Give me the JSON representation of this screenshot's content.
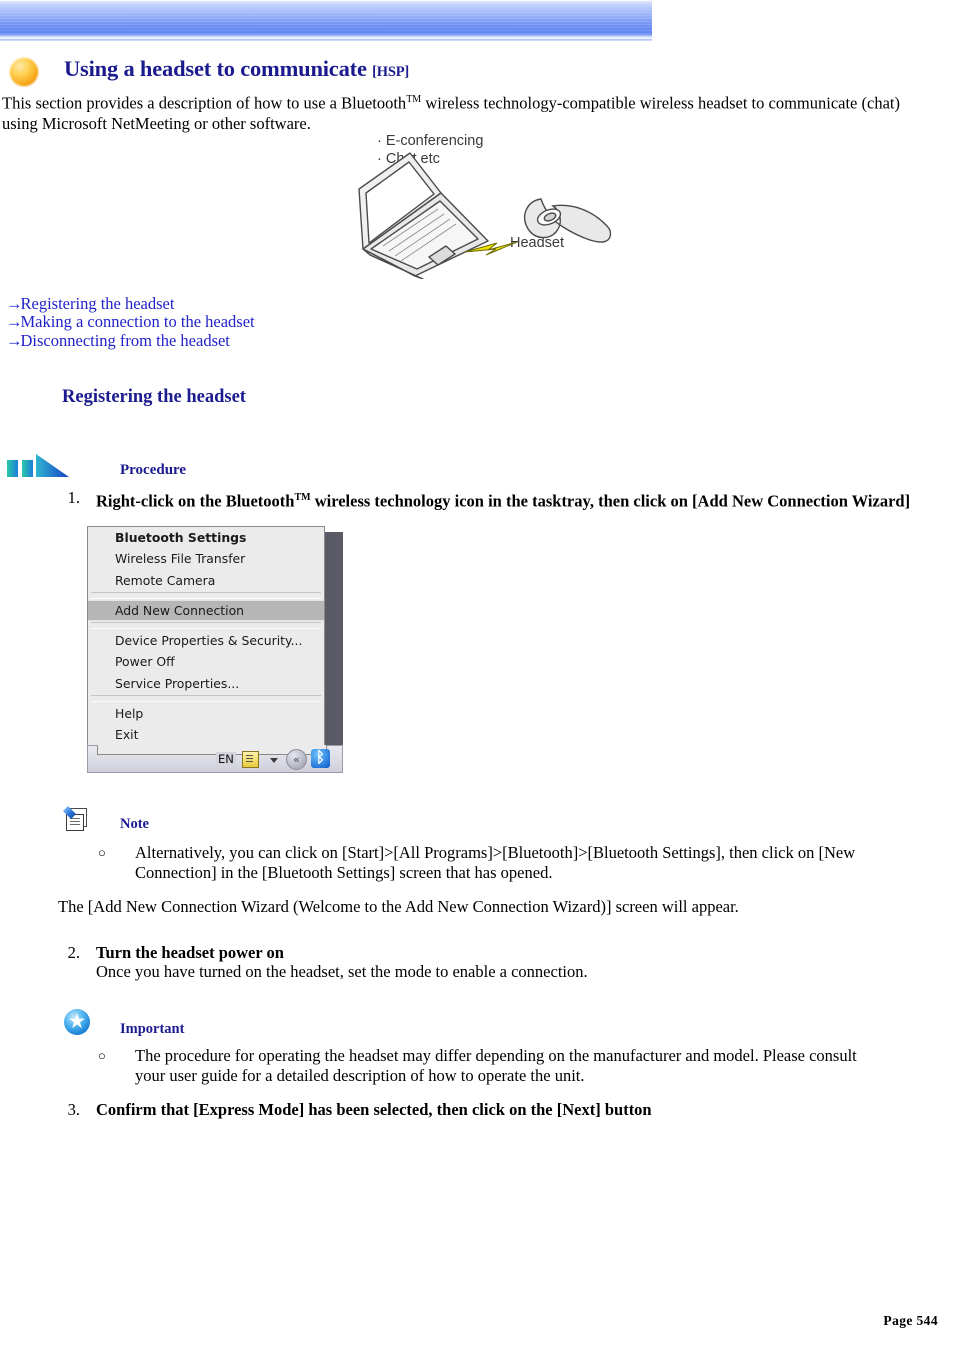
{
  "banner": {
    "accent_color": "#6287f2"
  },
  "header": {
    "icon": "orange-sphere-icon",
    "title": "Using a headset to communicate ",
    "title_suffix": "[HSP]",
    "title_color": "#1b1b8f"
  },
  "intro": {
    "part1": "This section provides a description of how to use a Bluetooth",
    "tm": "TM",
    "part2": " wireless technology-compatible wireless headset to communicate (chat) using Microsoft NetMeeting or other software."
  },
  "illustration": {
    "caption_line1": "· E-conferencing",
    "caption_line2": "· Chat etc",
    "headset_label": "Headset",
    "laptop_icon": "laptop-illustration",
    "bolt_icon": "lightning-bolt-icon",
    "headset_icon": "headset-illustration"
  },
  "links": {
    "arrow": "→",
    "items": [
      {
        "label": "Registering the headset"
      },
      {
        "label": "Making a connection to the headset"
      },
      {
        "label": "Disconnecting from the headset"
      }
    ],
    "color": "#2222cc"
  },
  "section": {
    "heading": "Registering the headset"
  },
  "procedure": {
    "label": "Procedure",
    "icon": "procedure-arrow-icon"
  },
  "steps": [
    {
      "num": "1.",
      "title": "Right-click on the Bluetooth",
      "tm": "TM",
      "title_rest": " wireless technology icon in the tasktray, then click on [Add New Connection Wizard]"
    },
    {
      "num": "2.",
      "title": "Turn the headset power on",
      "text": "Once you have turned on the headset, set the mode to enable a connection."
    },
    {
      "num": "3.",
      "title": "Confirm that [Express Mode] has been selected, then click on the [Next] button"
    }
  ],
  "screenshot": {
    "menu_items": [
      {
        "label": "Bluetooth Settings",
        "bold": true,
        "highlighted": false
      },
      {
        "label": "Wireless File Transfer",
        "bold": false,
        "highlighted": false
      },
      {
        "label": "Remote Camera",
        "bold": false,
        "highlighted": false
      },
      {
        "label": "Add New Connection",
        "bold": false,
        "highlighted": true
      },
      {
        "label": "Device Properties & Security...",
        "bold": false,
        "highlighted": false
      },
      {
        "label": "Power Off",
        "bold": false,
        "highlighted": false
      },
      {
        "label": "Service Properties...",
        "bold": false,
        "highlighted": false
      },
      {
        "label": "Help",
        "bold": false,
        "highlighted": false
      },
      {
        "label": "Exit",
        "bold": false,
        "highlighted": false
      }
    ],
    "tray": {
      "language": "EN",
      "notepad_icon": "notepad-tray-icon",
      "caret_icon": "chevron-down-icon",
      "circle_icon": "show-hidden-icons-icon",
      "circle_glyph": "«",
      "bluetooth_icon": "bluetooth-tray-icon",
      "bluetooth_glyph": "ᛒ"
    }
  },
  "note": {
    "icon": "note-icon",
    "label": "Note",
    "bullet": "○",
    "text": "Alternatively, you can click on [Start]>[All Programs]>[Bluetooth]>[Bluetooth Settings], then click on [New Connection] in the [Bluetooth Settings] screen that has opened."
  },
  "wizard_note": "The [Add New Connection Wizard (Welcome to the Add New Connection Wizard)] screen will appear.",
  "important": {
    "icon": "important-star-icon",
    "label": "Important",
    "bullet": "○",
    "text": "The procedure for operating the headset may differ depending on the manufacturer and model. Please consult your user guide for a detailed description of how to operate the unit."
  },
  "footer": {
    "page_label": "Page 544"
  }
}
